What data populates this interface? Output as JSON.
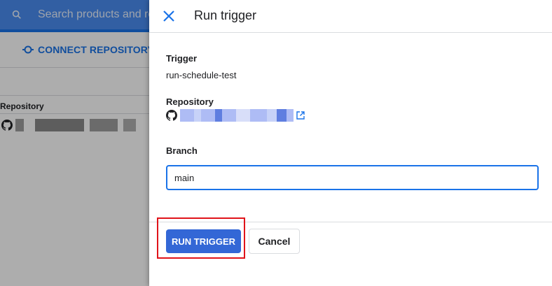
{
  "background": {
    "search_placeholder": "Search products and res",
    "connect_repository_label": "CONNECT REPOSITORY",
    "repository_column_header": "Repository"
  },
  "drawer": {
    "title": "Run trigger",
    "trigger_label": "Trigger",
    "trigger_value": "run-schedule-test",
    "repository_label": "Repository",
    "branch_label": "Branch",
    "branch_value": "main",
    "run_button_label": "RUN TRIGGER",
    "cancel_button_label": "Cancel"
  },
  "colors": {
    "accent": "#1a73e8",
    "run_button": "#3367d6",
    "highlight_box": "#e0131a"
  },
  "icons": [
    "search-icon",
    "connect-icon",
    "github-icon",
    "close-icon",
    "external-link-icon"
  ]
}
